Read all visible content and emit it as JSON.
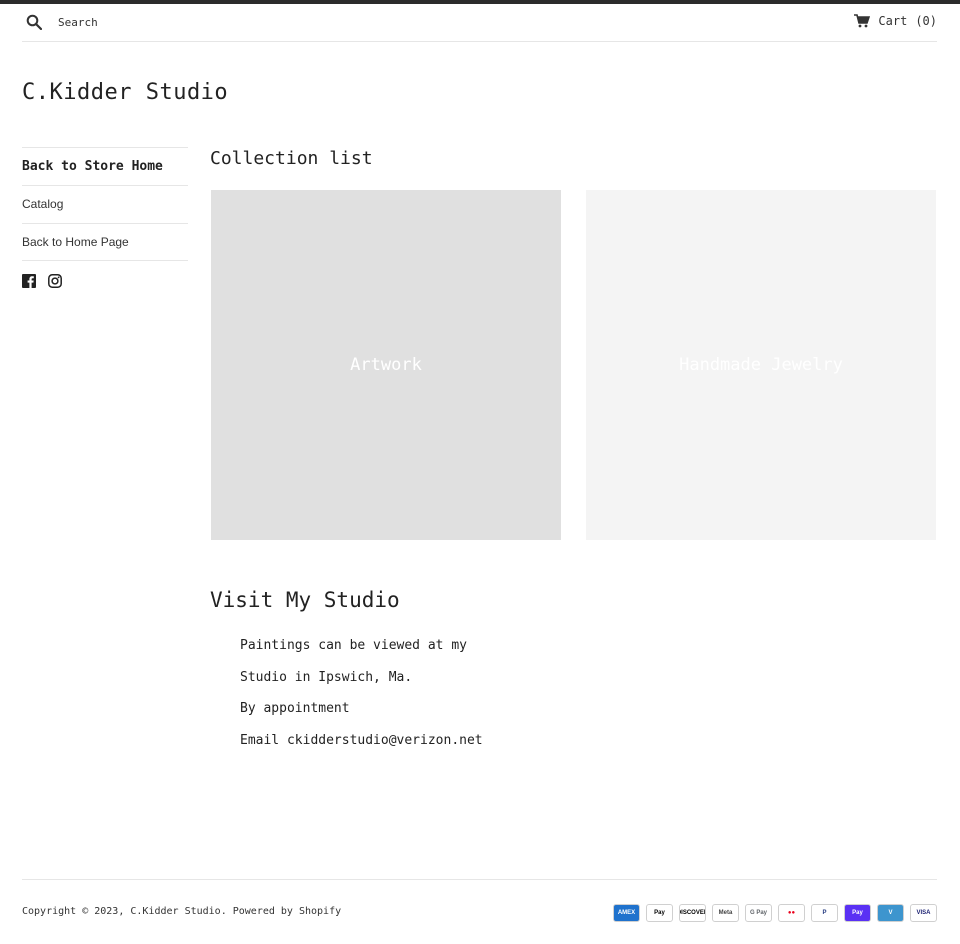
{
  "header": {
    "search_placeholder": "Search",
    "cart_label": "Cart",
    "cart_count": "(0)"
  },
  "site": {
    "title": "C.Kidder Studio"
  },
  "sidebar": {
    "items": [
      {
        "label": "Back to Store Home"
      },
      {
        "label": "Catalog"
      },
      {
        "label": "Back to Home Page"
      }
    ],
    "social": [
      "facebook-icon",
      "instagram-icon"
    ]
  },
  "collections": {
    "title": "Collection list",
    "items": [
      {
        "label": "Artwork"
      },
      {
        "label": "Handmade Jewelry"
      }
    ]
  },
  "studio": {
    "title": "Visit My Studio",
    "lines": [
      "Paintings can be viewed at my",
      "Studio in Ipswich, Ma.",
      "By appointment",
      "Email ckidderstudio@verizon.net"
    ]
  },
  "footer": {
    "copyright_prefix": "Copyright © 2023,",
    "store_link": "C.Kidder Studio",
    "powered_by": ". Powered by Shopify",
    "payments": [
      {
        "name": "AMEX",
        "bg": "#1f72cd",
        "fg": "#ffffff"
      },
      {
        "name": "Pay",
        "bg": "#ffffff",
        "fg": "#000000"
      },
      {
        "name": "DISCOVER",
        "bg": "#ffffff",
        "fg": "#000000"
      },
      {
        "name": "Meta",
        "bg": "#ffffff",
        "fg": "#444444"
      },
      {
        "name": "G Pay",
        "bg": "#ffffff",
        "fg": "#5f6368"
      },
      {
        "name": "●●",
        "bg": "#ffffff",
        "fg": "#eb001b"
      },
      {
        "name": "P",
        "bg": "#ffffff",
        "fg": "#253b80"
      },
      {
        "name": "Pay",
        "bg": "#5a31f4",
        "fg": "#ffffff"
      },
      {
        "name": "V",
        "bg": "#3d95ce",
        "fg": "#ffffff"
      },
      {
        "name": "VISA",
        "bg": "#ffffff",
        "fg": "#1a1f71"
      }
    ]
  }
}
